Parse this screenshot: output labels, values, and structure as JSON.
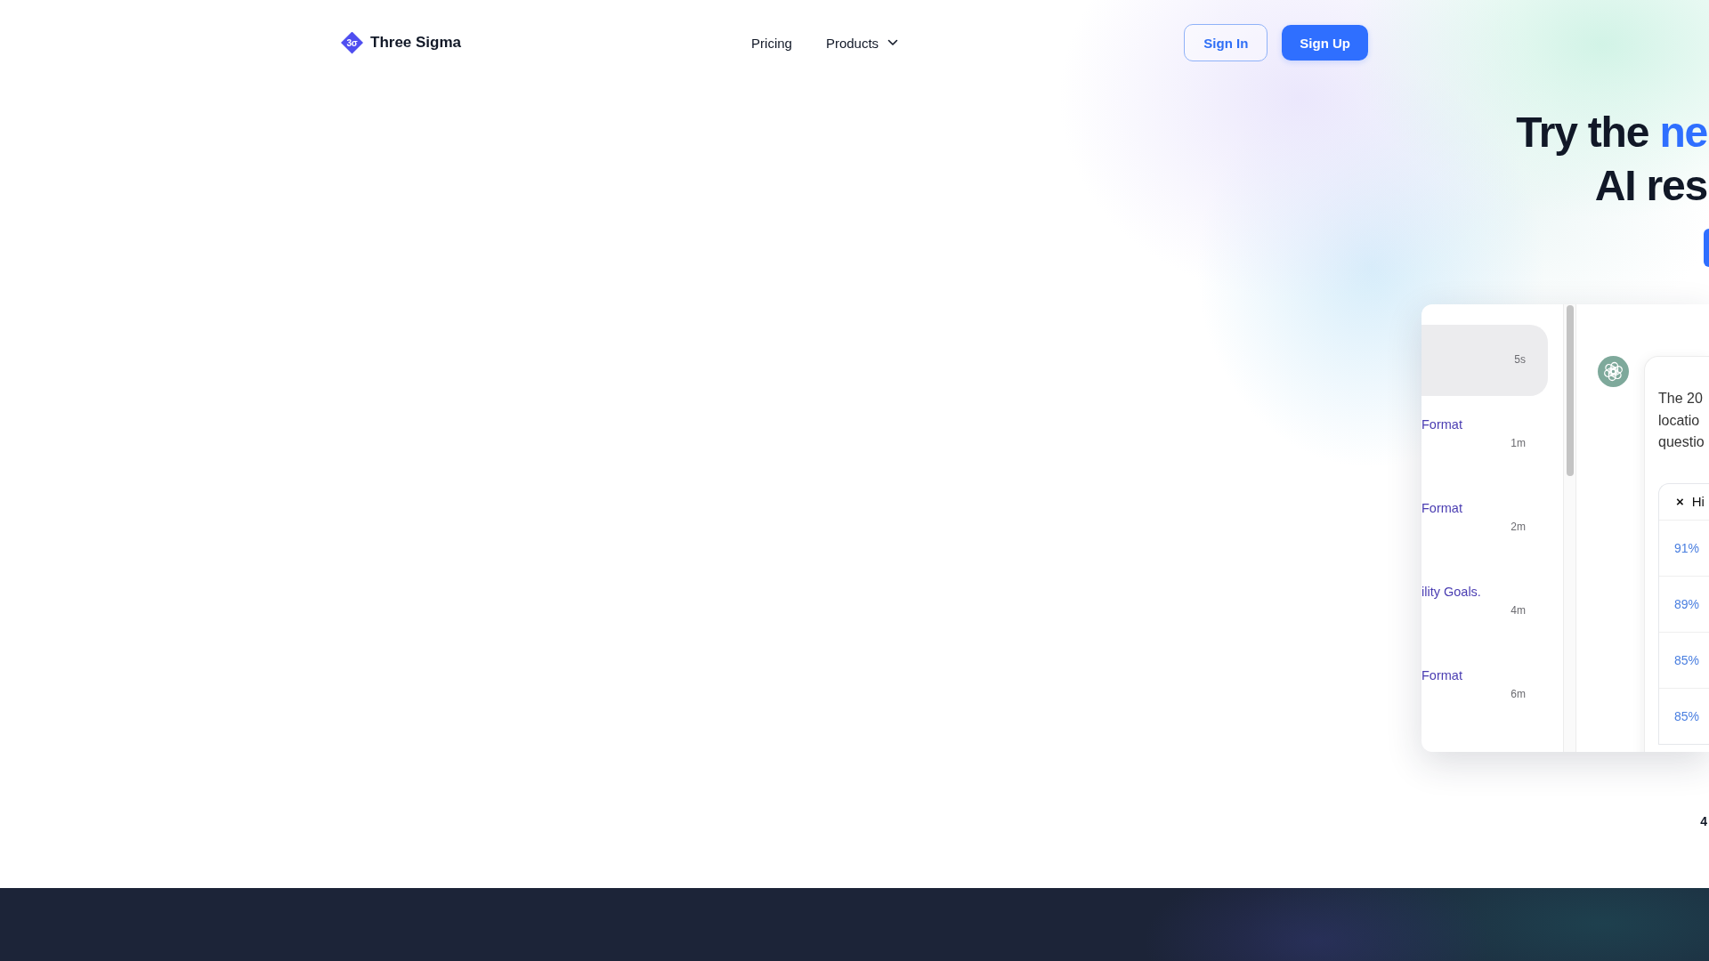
{
  "header": {
    "logo": {
      "mark": "3σ",
      "name": "Three Sigma"
    },
    "nav": [
      {
        "label": "Pricing",
        "kind": "link"
      },
      {
        "label": "Products",
        "kind": "dropdown"
      }
    ],
    "buttons": [
      {
        "label": "Sign In",
        "kind": "outline"
      },
      {
        "label": "Sign Up",
        "kind": "primary"
      }
    ]
  },
  "hero": {
    "heading": [
      [
        {
          "text": "Try the ",
          "accent": false
        },
        {
          "text": "ne",
          "accent": true
        }
      ],
      [
        {
          "text": "AI res",
          "accent": false
        }
      ]
    ],
    "cta": {
      "kind": "primary"
    }
  },
  "demo": {
    "conversations": [
      {
        "time": "5s",
        "selected": true
      },
      {
        "title": "Format",
        "time": "1m",
        "selected": false
      },
      {
        "title": "Format",
        "time": "2m",
        "selected": false
      },
      {
        "title": "ility Goals.",
        "time": "4m",
        "selected": false
      },
      {
        "title": "Format",
        "time": "6m",
        "selected": false
      }
    ],
    "message": {
      "text_lines": [
        "The 20",
        "locatio",
        "questio"
      ],
      "table": {
        "header": [
          {
            "text": "×",
            "kind": "icon"
          },
          {
            "text": "Hi",
            "kind": "label"
          }
        ],
        "rows": [
          [
            "91%"
          ],
          [
            "89%"
          ],
          [
            "85%"
          ],
          [
            "85%"
          ]
        ]
      }
    }
  },
  "stats": {
    "column_1": "4"
  }
}
